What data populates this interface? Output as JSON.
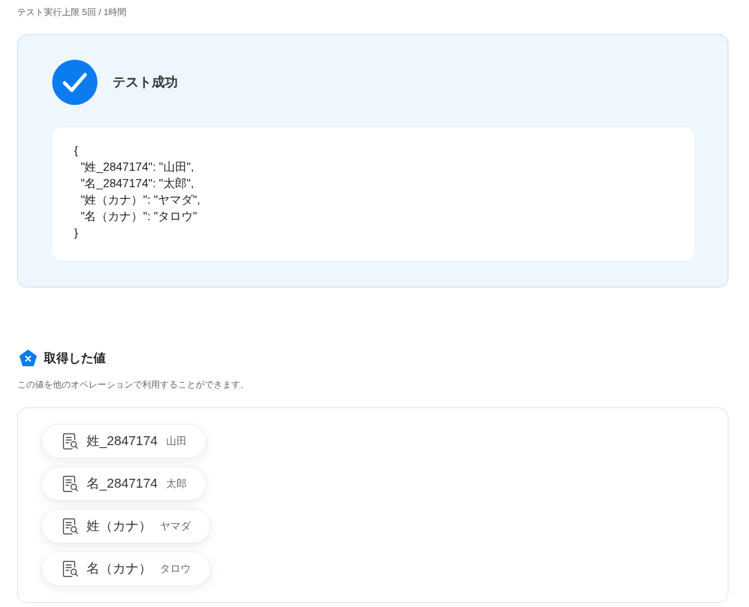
{
  "header": {
    "test_limit": "テスト実行上限 5回 / 1時間"
  },
  "test_result": {
    "passed": true,
    "title": "テスト成功",
    "output_lines": [
      "{",
      "  \"姓_2847174\": \"山田\",",
      "  \"名_2847174\": \"太郎\",",
      "  \"姓（カナ）\": \"ヤマダ\",",
      "  \"名（カナ）\": \"タロウ\"",
      "}"
    ]
  },
  "retrieved_values": {
    "title": "取得した値",
    "description": "この値を他のオペレーションで利用することができます。",
    "items": [
      {
        "name": "姓_2847174",
        "value": "山田"
      },
      {
        "name": "名_2847174",
        "value": "太郎"
      },
      {
        "name": "姓（カナ）",
        "value": "ヤマダ"
      },
      {
        "name": "名（カナ）",
        "value": "タロウ"
      }
    ]
  }
}
